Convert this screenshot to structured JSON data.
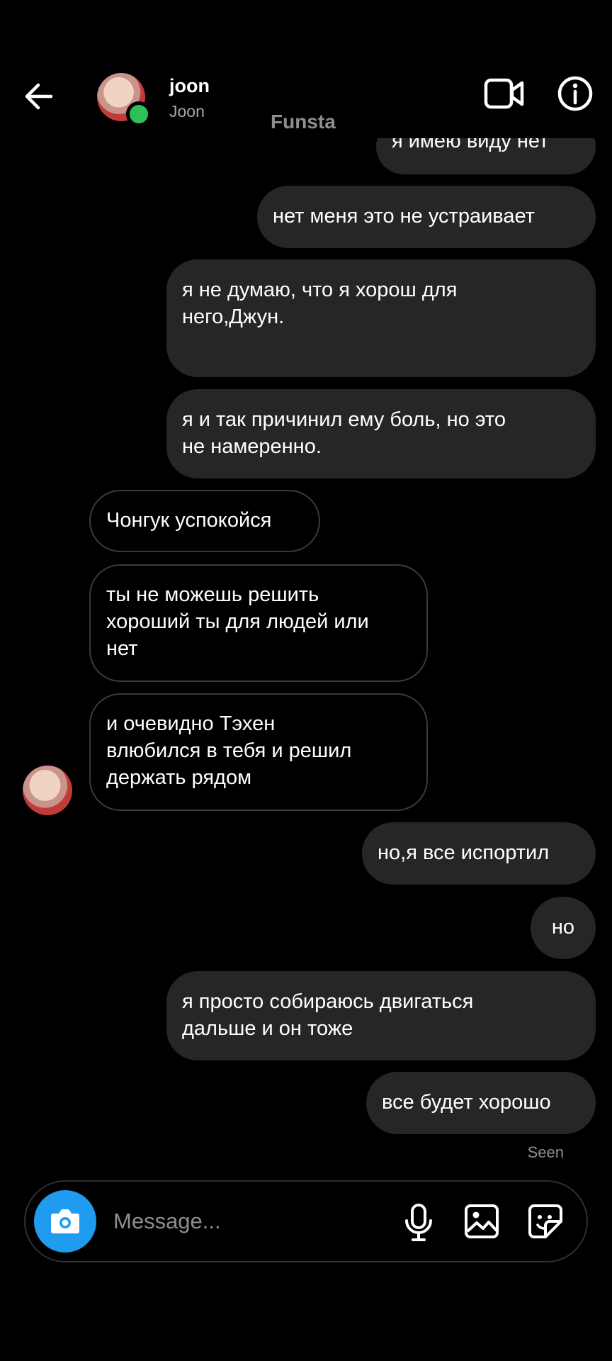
{
  "header": {
    "contact_name": "joon",
    "contact_subtitle": "Joon",
    "overlay_label": "Funsta",
    "back_icon": "arrow-left-icon",
    "video_icon": "video-call-icon",
    "info_icon": "info-icon"
  },
  "messages": [
    {
      "direction": "outgoing",
      "text": "я имею виду нет"
    },
    {
      "direction": "outgoing",
      "text": "нет меня это не устраивает"
    },
    {
      "direction": "outgoing",
      "text": "я не думаю, что я хорош для\nнего,Джун."
    },
    {
      "direction": "outgoing",
      "text": "я и так причинил ему боль, но это\nне намеренно."
    },
    {
      "direction": "incoming",
      "text": "Чонгук успокойся"
    },
    {
      "direction": "incoming",
      "text": "ты не можешь решить\nхороший ты для людей или\nнет"
    },
    {
      "direction": "incoming",
      "text": "и очевидно Тэхен\nвлюбился в тебя и решил\nдержать рядом"
    },
    {
      "direction": "outgoing",
      "text": "но,я все испортил"
    },
    {
      "direction": "outgoing",
      "text": "но"
    },
    {
      "direction": "outgoing",
      "text": "я просто собираюсь двигаться\nдальше и он тоже"
    },
    {
      "direction": "outgoing",
      "text": "все будет хорошо"
    }
  ],
  "status": {
    "seen": "Seen"
  },
  "composer": {
    "placeholder": "Message...",
    "camera_icon": "camera-icon",
    "mic_icon": "microphone-icon",
    "gallery_icon": "gallery-icon",
    "sticker_icon": "sticker-icon"
  },
  "colors": {
    "background": "#000000",
    "outgoing_bubble": "#262626",
    "accent": "#1f9bf0",
    "online": "#2fbf5a"
  }
}
